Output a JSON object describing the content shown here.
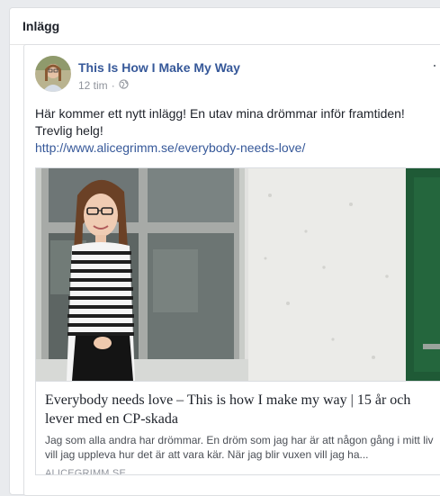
{
  "section": {
    "title": "Inlägg"
  },
  "post": {
    "author": "This Is How I Make My Way",
    "time": "12 tim",
    "separator": "·",
    "privacy_icon": "globe-icon",
    "more_icon": "more-options-icon",
    "more_label": "···",
    "text_line1": "Här kommer ett nytt inlägg! En utav mina drömmar inför framtiden!",
    "text_line2": "Trevlig helg!",
    "link": "http://www.alicegrimm.se/everybody-needs-love/"
  },
  "preview": {
    "title": "Everybody needs love – This is how I make my way | 15 år och lever med en CP-skada",
    "description": "Jag som alla andra har drömmar. En dröm som jag har är att någon gång i mitt liv vill jag uppleva hur det är att vara kär. När jag blir vuxen vill jag ha...",
    "domain": "ALICEGRIMM.SE"
  },
  "colors": {
    "link_blue": "#365899",
    "meta_gray": "#90949c",
    "door_green": "#1f5a36"
  }
}
